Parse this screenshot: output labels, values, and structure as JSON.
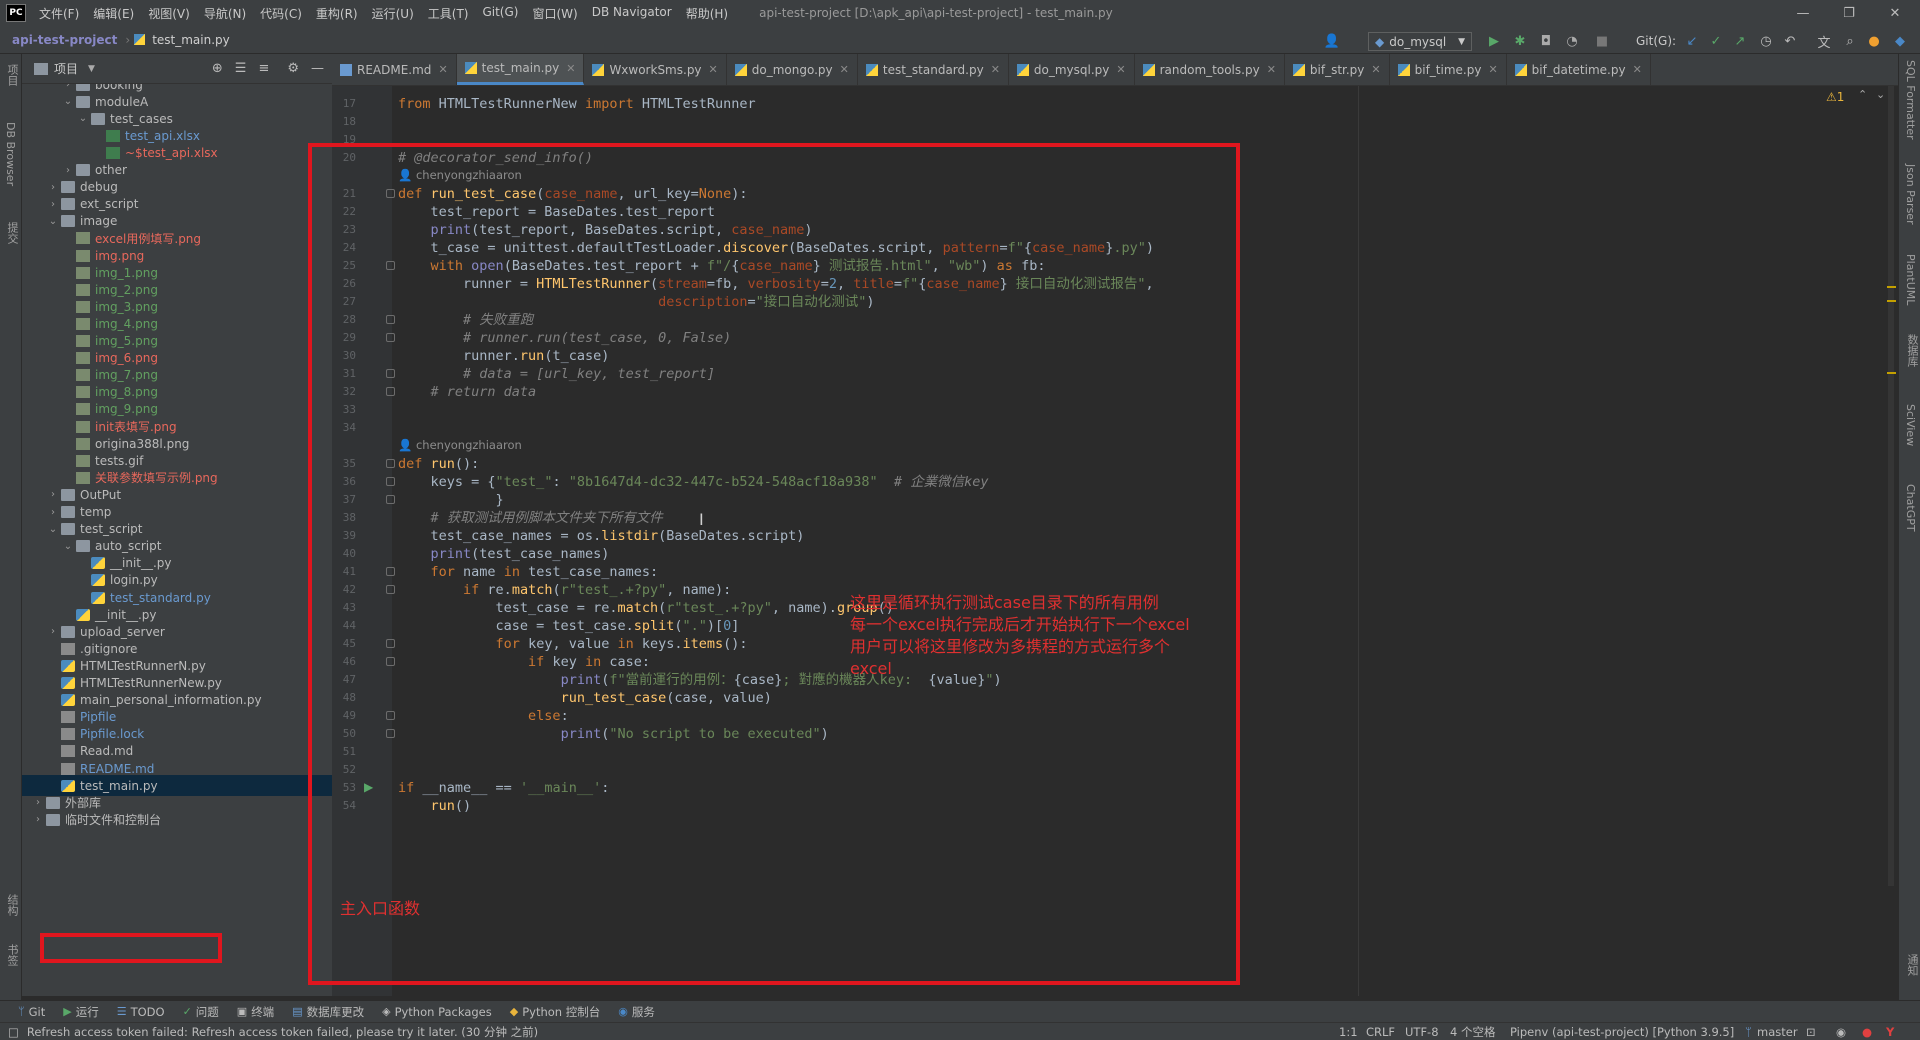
{
  "app": {
    "logo": "PC",
    "window_title": "api-test-project [D:\\apk_api\\api-test-project] - test_main.py",
    "menu": [
      "文件(F)",
      "编辑(E)",
      "视图(V)",
      "导航(N)",
      "代码(C)",
      "重构(R)",
      "运行(U)",
      "工具(T)",
      "Git(G)",
      "窗口(W)",
      "DB Navigator",
      "帮助(H)"
    ],
    "window_controls": [
      "—",
      "❐",
      "✕"
    ]
  },
  "nav": {
    "project": "api-test-project",
    "file": "test_main.py",
    "run_config": "do_mysql",
    "git_label": "Git(G):"
  },
  "left_strip": [
    "DB Browser",
    "提交"
  ],
  "left_strip_bottom": [
    "结构",
    "书签"
  ],
  "right_strip": [
    "SQL Formatter",
    "Json Parser",
    "PlantUML",
    "数据库",
    "SciView",
    "ChatGPT",
    "通知"
  ],
  "project_panel": {
    "title": "项目",
    "tree": [
      {
        "label": "booking",
        "depth": 2,
        "type": "folder",
        "arrow": "›",
        "color": "normal"
      },
      {
        "label": "moduleA",
        "depth": 2,
        "type": "folder",
        "arrow": "⌄",
        "color": "normal"
      },
      {
        "label": "test_cases",
        "depth": 3,
        "type": "folder",
        "arrow": "⌄",
        "color": "normal"
      },
      {
        "label": "test_api.xlsx",
        "depth": 4,
        "type": "xls",
        "arrow": "",
        "color": "blue"
      },
      {
        "label": "~$test_api.xlsx",
        "depth": 4,
        "type": "xls",
        "arrow": "",
        "color": "red"
      },
      {
        "label": "other",
        "depth": 2,
        "type": "folder",
        "arrow": "›",
        "color": "normal"
      },
      {
        "label": "debug",
        "depth": 1,
        "type": "folder",
        "arrow": "›",
        "color": "normal"
      },
      {
        "label": "ext_script",
        "depth": 1,
        "type": "folder",
        "arrow": "›",
        "color": "normal"
      },
      {
        "label": "image",
        "depth": 1,
        "type": "folder",
        "arrow": "⌄",
        "color": "normal"
      },
      {
        "label": "excel用例填写.png",
        "depth": 2,
        "type": "img",
        "arrow": "",
        "color": "red"
      },
      {
        "label": "img.png",
        "depth": 2,
        "type": "img",
        "arrow": "",
        "color": "red"
      },
      {
        "label": "img_1.png",
        "depth": 2,
        "type": "img",
        "arrow": "",
        "color": "green"
      },
      {
        "label": "img_2.png",
        "depth": 2,
        "type": "img",
        "arrow": "",
        "color": "green"
      },
      {
        "label": "img_3.png",
        "depth": 2,
        "type": "img",
        "arrow": "",
        "color": "green"
      },
      {
        "label": "img_4.png",
        "depth": 2,
        "type": "img",
        "arrow": "",
        "color": "green"
      },
      {
        "label": "img_5.png",
        "depth": 2,
        "type": "img",
        "arrow": "",
        "color": "green"
      },
      {
        "label": "img_6.png",
        "depth": 2,
        "type": "img",
        "arrow": "",
        "color": "red"
      },
      {
        "label": "img_7.png",
        "depth": 2,
        "type": "img",
        "arrow": "",
        "color": "green"
      },
      {
        "label": "img_8.png",
        "depth": 2,
        "type": "img",
        "arrow": "",
        "color": "green"
      },
      {
        "label": "img_9.png",
        "depth": 2,
        "type": "img",
        "arrow": "",
        "color": "green"
      },
      {
        "label": "init表填写.png",
        "depth": 2,
        "type": "img",
        "arrow": "",
        "color": "red"
      },
      {
        "label": "origina388l.png",
        "depth": 2,
        "type": "img",
        "arrow": "",
        "color": "normal"
      },
      {
        "label": "tests.gif",
        "depth": 2,
        "type": "img",
        "arrow": "",
        "color": "normal"
      },
      {
        "label": "关联参数填写示例.png",
        "depth": 2,
        "type": "img",
        "arrow": "",
        "color": "red"
      },
      {
        "label": "OutPut",
        "depth": 1,
        "type": "folder",
        "arrow": "›",
        "color": "normal"
      },
      {
        "label": "temp",
        "depth": 1,
        "type": "folder",
        "arrow": "›",
        "color": "normal"
      },
      {
        "label": "test_script",
        "depth": 1,
        "type": "folder",
        "arrow": "⌄",
        "color": "normal"
      },
      {
        "label": "auto_script",
        "depth": 2,
        "type": "folder",
        "arrow": "⌄",
        "color": "normal"
      },
      {
        "label": "__init__.py",
        "depth": 3,
        "type": "py",
        "arrow": "",
        "color": "normal"
      },
      {
        "label": "login.py",
        "depth": 3,
        "type": "py",
        "arrow": "",
        "color": "normal"
      },
      {
        "label": "test_standard.py",
        "depth": 3,
        "type": "py",
        "arrow": "",
        "color": "blue"
      },
      {
        "label": "__init__.py",
        "depth": 2,
        "type": "py",
        "arrow": "",
        "color": "normal"
      },
      {
        "label": "upload_server",
        "depth": 1,
        "type": "folder",
        "arrow": "›",
        "color": "normal"
      },
      {
        "label": ".gitignore",
        "depth": 1,
        "type": "txt",
        "arrow": "",
        "color": "normal"
      },
      {
        "label": "HTMLTestRunnerN.py",
        "depth": 1,
        "type": "py",
        "arrow": "",
        "color": "normal"
      },
      {
        "label": "HTMLTestRunnerNew.py",
        "depth": 1,
        "type": "py",
        "arrow": "",
        "color": "normal"
      },
      {
        "label": "main_personal_information.py",
        "depth": 1,
        "type": "py",
        "arrow": "",
        "color": "normal"
      },
      {
        "label": "Pipfile",
        "depth": 1,
        "type": "txt",
        "arrow": "",
        "color": "blue"
      },
      {
        "label": "Pipfile.lock",
        "depth": 1,
        "type": "txt",
        "arrow": "",
        "color": "blue"
      },
      {
        "label": "Read.md",
        "depth": 1,
        "type": "txt",
        "arrow": "",
        "color": "normal"
      },
      {
        "label": "README.md",
        "depth": 1,
        "type": "txt",
        "arrow": "",
        "color": "blue"
      },
      {
        "label": "test_main.py",
        "depth": 1,
        "type": "py",
        "arrow": "",
        "color": "normal",
        "selected": true
      },
      {
        "label": "外部库",
        "depth": 0,
        "type": "folder",
        "arrow": "›",
        "color": "normal"
      },
      {
        "label": "临时文件和控制台",
        "depth": 0,
        "type": "folder",
        "arrow": "›",
        "color": "normal"
      }
    ]
  },
  "tabs": [
    {
      "label": "README.md",
      "active": false
    },
    {
      "label": "test_main.py",
      "active": true
    },
    {
      "label": "WxworkSms.py",
      "active": false
    },
    {
      "label": "do_mongo.py",
      "active": false
    },
    {
      "label": "test_standard.py",
      "active": false
    },
    {
      "label": "do_mysql.py",
      "active": false
    },
    {
      "label": "random_tools.py",
      "active": false
    },
    {
      "label": "bif_str.py",
      "active": false
    },
    {
      "label": "bif_time.py",
      "active": false
    },
    {
      "label": "bif_datetime.py",
      "active": false
    }
  ],
  "inspection": "⚠1",
  "code": {
    "author": "chenyongzhiaaron",
    "lines": [
      {
        "n": "17",
        "html": "<span class='k'>from</span> HTMLTestRunnerNew <span class='k'>import</span> HTMLTestRunner"
      },
      {
        "n": "18",
        "html": ""
      },
      {
        "n": "19",
        "html": ""
      },
      {
        "n": "20",
        "html": "<span class='c'># @decorator_send_info()</span>"
      },
      {
        "n": "21",
        "html": "<span class='k'>def</span> <span class='f'>run_test_case</span>(<span class='p'>case_name</span>, url_key=<span class='k'>None</span>):"
      },
      {
        "n": "22",
        "html": "    test_report = BaseDates.test_report"
      },
      {
        "n": "23",
        "html": "    <span class='b'>print</span>(test_report, BaseDates.script, <span class='p'>case_name</span>)"
      },
      {
        "n": "24",
        "html": "    t_case = unittest.defaultTestLoader.<span class='f'>discover</span>(BaseDates.script, <span class='p'>pattern</span>=<span class='s'>f\"</span>{<span class='p'>case_name</span>}<span class='s'>.py\"</span>)"
      },
      {
        "n": "25",
        "html": "    <span class='k'>with</span> <span class='b'>open</span>(BaseDates.test_report + <span class='s'>f\"/</span>{<span class='p'>case_name</span>}<span class='s'> 测试报告.html\"</span>, <span class='s'>\"wb\"</span>) <span class='k'>as</span> fb:"
      },
      {
        "n": "26",
        "html": "        runner = <span class='f'>HTMLTestRunner</span>(<span class='p'>stream</span>=fb, <span class='p'>verbosity</span>=<span class='n'>2</span>, <span class='p'>title</span>=<span class='s'>f\"</span>{<span class='p'>case_name</span>}<span class='s'> 接口自动化测试报告\"</span>,"
      },
      {
        "n": "27",
        "html": "                                <span class='p'>description</span>=<span class='s'>\"接口自动化测试\"</span>)"
      },
      {
        "n": "28",
        "html": "        <span class='c'># 失败重跑</span>"
      },
      {
        "n": "29",
        "html": "        <span class='c'># runner.run(test_case, 0, False)</span>"
      },
      {
        "n": "30",
        "html": "        runner.<span class='f'>run</span>(t_case)"
      },
      {
        "n": "31",
        "html": "        <span class='c'># data = [url_key, test_report]</span>"
      },
      {
        "n": "32",
        "html": "    <span class='c'># return data</span>"
      },
      {
        "n": "33",
        "html": ""
      },
      {
        "n": "34",
        "html": ""
      },
      {
        "n": "35",
        "html": "<span class='k'>def</span> <span class='f'>run</span>():"
      },
      {
        "n": "36",
        "html": "    keys = {<span class='s'>\"test_\"</span>: <span class='s'>\"8b1647d4-dc32-447c-b524-548acf18a938\"</span>  <span class='c'># 企業微信key</span>"
      },
      {
        "n": "37",
        "html": "            }"
      },
      {
        "n": "38",
        "html": "    <span class='c'># 获取测试用例脚本文件夹下所有文件</span>"
      },
      {
        "n": "39",
        "html": "    test_case_names = os.<span class='f'>listdir</span>(BaseDates.script)"
      },
      {
        "n": "40",
        "html": "    <span class='b'>print</span>(test_case_names)"
      },
      {
        "n": "41",
        "html": "    <span class='k'>for</span> name <span class='k'>in</span> test_case_names:"
      },
      {
        "n": "42",
        "html": "        <span class='k'>if</span> re.<span class='f'>match</span>(<span class='s'>r\"test_.+?py\"</span>, name):"
      },
      {
        "n": "43",
        "html": "            test_case = re.<span class='f'>match</span>(<span class='s'>r\"test_.+?py\"</span>, name).<span class='f'>group</span>()"
      },
      {
        "n": "44",
        "html": "            case = test_case.<span class='f'>split</span>(<span class='s'>\".\"</span>)[<span class='n'>0</span>]"
      },
      {
        "n": "45",
        "html": "            <span class='k'>for</span> key, value <span class='k'>in</span> keys.<span class='f'>items</span>():"
      },
      {
        "n": "46",
        "html": "                <span class='k'>if</span> key <span class='k'>in</span> case:"
      },
      {
        "n": "47",
        "html": "                    <span class='b'>print</span>(<span class='s'>f\"當前運行的用例：</span>{case}<span class='s'>; 對應的機器人key:  </span>{value}<span class='s'>\"</span>)"
      },
      {
        "n": "48",
        "html": "                    <span class='f'>run_test_case</span>(case, value)"
      },
      {
        "n": "49",
        "html": "                <span class='k'>else</span>:"
      },
      {
        "n": "50",
        "html": "                    <span class='b'>print</span>(<span class='s'>\"No script to be executed\"</span>)"
      },
      {
        "n": "51",
        "html": ""
      },
      {
        "n": "52",
        "html": ""
      },
      {
        "n": "53",
        "html": "<span class='k'>if</span> __name__ == <span class='s'>'__main__'</span>:"
      },
      {
        "n": "54",
        "html": "    <span class='f'>run</span>()"
      }
    ]
  },
  "annotations": {
    "note_main": "这里是循环执行测试case目录下的所有用例\n每一个excel执行完成后才开始执行下一个excel\n用户可以将这里修改为多携程的方式运行多个\nexcel",
    "note_entry": "主入口函数"
  },
  "bottom_tools": [
    "Git",
    "运行",
    "TODO",
    "问题",
    "终端",
    "数据库更改",
    "Python Packages",
    "Python 控制台",
    "服务"
  ],
  "status": {
    "message": "Refresh access token failed: Refresh access token failed, please try it later. (30 分钟 之前)",
    "position": "1:1",
    "line_sep": "CRLF",
    "encoding": "UTF-8",
    "indent": "4 个空格",
    "interpreter": "Pipenv (api-test-project) [Python 3.9.5]",
    "branch": "master"
  },
  "colors": {
    "accent": "#4a88c7",
    "annotation_red": "#e0161e",
    "editor_bg": "#2b2b2b",
    "panel_bg": "#3c3f41"
  }
}
